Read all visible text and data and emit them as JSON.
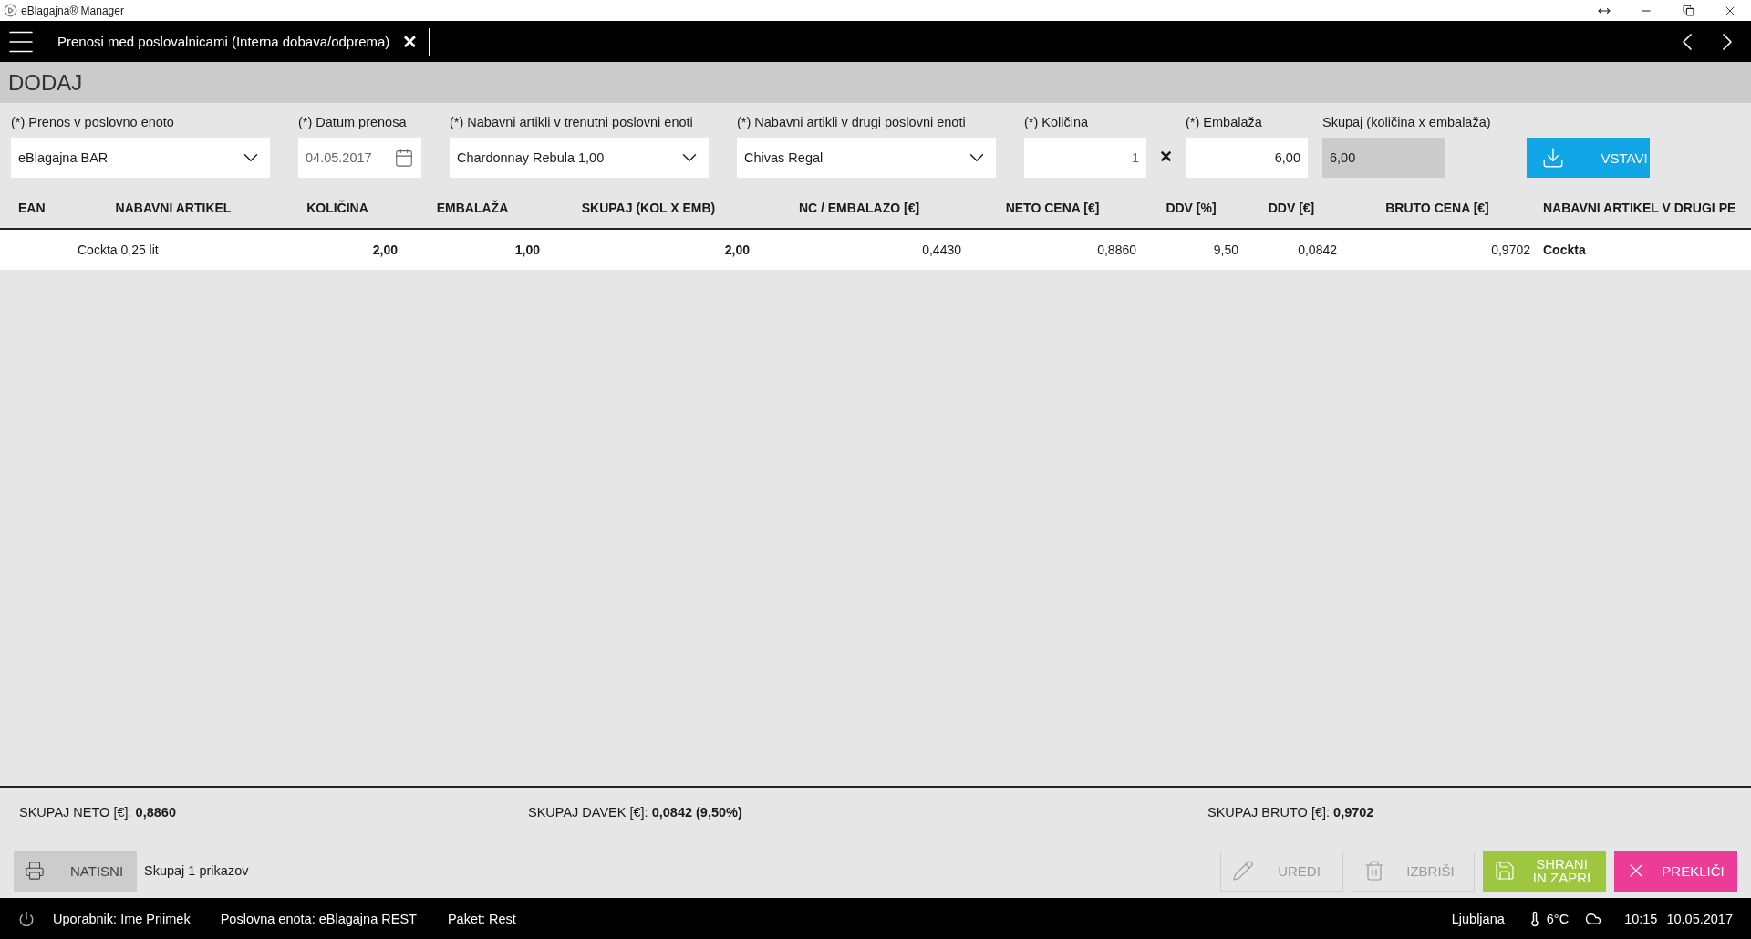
{
  "window": {
    "title": "eBlagajna® Manager"
  },
  "header": {
    "tab_title": "Prenosi med poslovalnicami (Interna dobava/odprema)",
    "close": "✕"
  },
  "section_title": "DODAJ",
  "form": {
    "fields": [
      {
        "kind": "select",
        "label": "(*) Prenos v poslovno enoto",
        "value": "eBlagajna BAR"
      },
      {
        "kind": "date",
        "label": "(*) Datum prenosa",
        "value": "04.05.2017"
      },
      {
        "kind": "select",
        "label": "(*) Nabavni artikli v trenutni poslovni enoti",
        "value": "Chardonnay Rebula 1,00"
      },
      {
        "kind": "select",
        "label": "(*) Nabavni artikli v drugi poslovni enoti",
        "value": "Chivas Regal"
      },
      {
        "kind": "number",
        "label": "(*) Količina",
        "value": "1",
        "operator": "✕"
      },
      {
        "kind": "number",
        "label": "(*) Embalaža",
        "value": "6,00"
      },
      {
        "kind": "readonly",
        "label": "Skupaj (količina x embalaža)",
        "value": "6,00"
      }
    ],
    "insert_button": "VSTAVI"
  },
  "table": {
    "columns": [
      "EAN",
      "NABAVNI ARTIKEL",
      "KOLIČINA",
      "EMBALAŽA",
      "SKUPAJ (KOL X EMB)",
      "NC / EMBALAZO [€]",
      "NETO CENA [€]",
      "DDV [%]",
      "DDV [€]",
      "BRUTO CENA [€]",
      "NABAVNI ARTIKEL V DRUGI PE"
    ],
    "rows": [
      {
        "cells": [
          "",
          "Cockta 0,25 lit",
          "2,00",
          "1,00",
          "2,00",
          "0,4430",
          "0,8860",
          "9,50",
          "0,0842",
          "0,9702",
          "Cockta"
        ]
      }
    ]
  },
  "totals": [
    "SKUPAJ NETO [€]: **0,8860**",
    "SKUPAJ DAVEK [€]: **0,0842 (9,50%)**",
    "SKUPAJ BRUTO [€]: **0,9702**"
  ],
  "actions": {
    "print": "NATISNI",
    "count": "Skupaj 1 prikazov",
    "buttons": [
      {
        "kind": "edit",
        "label": "UREDI",
        "disabled": true
      },
      {
        "kind": "delete",
        "label": "IZBRIŠI",
        "disabled": true
      },
      {
        "kind": "save",
        "label": "SHRANI IN ZAPRI",
        "disabled": false
      },
      {
        "kind": "cancel",
        "label": "PREKLIČI",
        "disabled": false
      }
    ]
  },
  "status_bar": {
    "user": "Uporabnik: Ime Priimek",
    "unit": "Poslovna enota: eBlagajna REST",
    "package": "Paket: Rest",
    "city": "Ljubljana",
    "temperature": "6°C",
    "time": "10:15",
    "date": "10.05.2017"
  }
}
